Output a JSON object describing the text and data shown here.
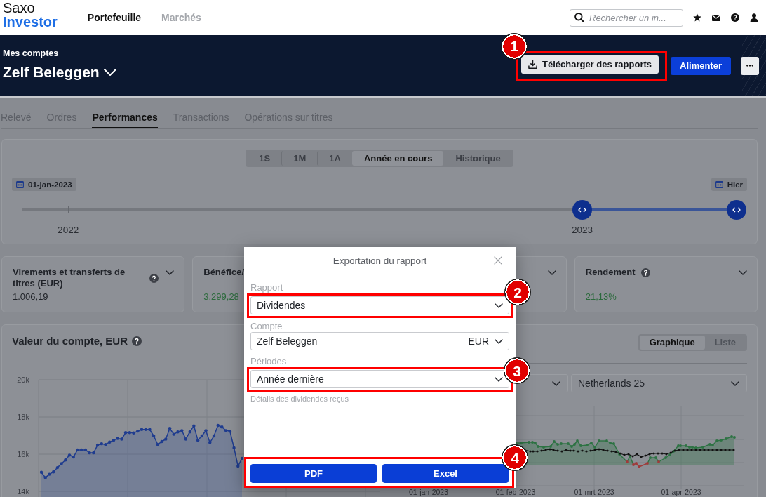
{
  "top_bar": {
    "logo": {
      "line_1": "Saxo",
      "line_2": "Investor"
    },
    "nav": [
      {
        "label": "Portefeuille",
        "selected": true
      },
      {
        "label": "Marchés",
        "selected": false
      }
    ],
    "search": {
      "placeholder": "Rechercher un in..."
    }
  },
  "account_header": {
    "caption": "Mes comptes",
    "account": "Zelf Beleggen",
    "download_button": {
      "label": "Télécharger des rapports",
      "callout": "1"
    },
    "fund_button": {
      "label": "Alimenter"
    }
  },
  "tabs": [
    {
      "label": "Relevé",
      "selected": false
    },
    {
      "label": "Ordres",
      "selected": false
    },
    {
      "label": "Performances",
      "selected": true
    },
    {
      "label": "Transactions",
      "selected": false
    },
    {
      "label": "Opérations sur titres",
      "selected": false
    }
  ],
  "period": {
    "ranges": [
      {
        "label": "1S",
        "selected": false
      },
      {
        "label": "1M",
        "selected": false
      },
      {
        "label": "1A",
        "selected": false
      },
      {
        "label": "Année en cours",
        "selected": true
      },
      {
        "label": "Historique",
        "selected": false
      }
    ],
    "start_date": "01-jan-2023",
    "end_date": "Hier",
    "timeline": {
      "years": [
        {
          "label": "2022",
          "level": 0.064
        },
        {
          "label": "2023",
          "level": 0.784
        }
      ],
      "handles": [
        {
          "level": 0.784
        },
        {
          "level": 1
        }
      ]
    }
  },
  "summary_cards": [
    {
      "title": "Virements et transferts de titres (EUR)",
      "help": true,
      "expanded": false,
      "value": "1.006,19",
      "positive": false
    },
    {
      "title": "Bénéfice/",
      "value": "3.299,28",
      "positive": true
    },
    {
      "expanded": false
    },
    {
      "title": "Rendement",
      "help": true,
      "expanded": false,
      "value": "21,13%",
      "positive": true
    }
  ],
  "account_value": {
    "title": "Valeur du compte, EUR",
    "help": true,
    "chart_data": {
      "type": "area",
      "ylim": [
        14000,
        20000
      ],
      "yticks": [
        {
          "value": 14000,
          "label": "14k"
        },
        {
          "value": 16000,
          "label": "16k"
        },
        {
          "value": 18000,
          "label": "18k"
        },
        {
          "value": 20000,
          "label": "20k"
        }
      ],
      "values": [
        15030,
        14740,
        14920,
        15050,
        15280,
        15490,
        15690,
        15950,
        15850,
        16230,
        16230,
        16230,
        16070,
        16070,
        16490,
        16560,
        16520,
        16650,
        16750,
        16850,
        16810,
        17160,
        17160,
        17140,
        17240,
        17330,
        17330,
        17330,
        16980,
        16520,
        16680,
        16810,
        17390,
        17070,
        17200,
        17270,
        16810,
        17200,
        17520,
        16750,
        16980,
        17270,
        16620,
        16980,
        17550,
        17460,
        17270,
        17240,
        16340,
        15360,
        15780
      ]
    }
  },
  "comparison": {
    "views": [
      {
        "label": "Graphique",
        "selected": true
      },
      {
        "label": "Liste",
        "selected": false
      }
    ],
    "filters": [
      {
        "expanded": false
      },
      {
        "value": "Netherlands 25",
        "expanded": false
      }
    ],
    "x_labels": [
      "01-jan-2023",
      "01-feb-2023",
      "01-mrt-2023",
      "01-apr-2023"
    ]
  },
  "export_dialog": {
    "title": "Exportation du rapport",
    "fields": [
      {
        "label": "Rapport",
        "value": "Dividendes",
        "callout": "2"
      },
      {
        "label": "Compte",
        "value": "Zelf Beleggen",
        "currency": "EUR"
      },
      {
        "label": "Périodes",
        "value": "Année dernière",
        "callout": "3"
      }
    ],
    "hint": "Détails des dividendes reçus",
    "actions": {
      "callout": "4",
      "buttons": [
        {
          "label": "PDF"
        },
        {
          "label": "Excel"
        }
      ]
    }
  }
}
